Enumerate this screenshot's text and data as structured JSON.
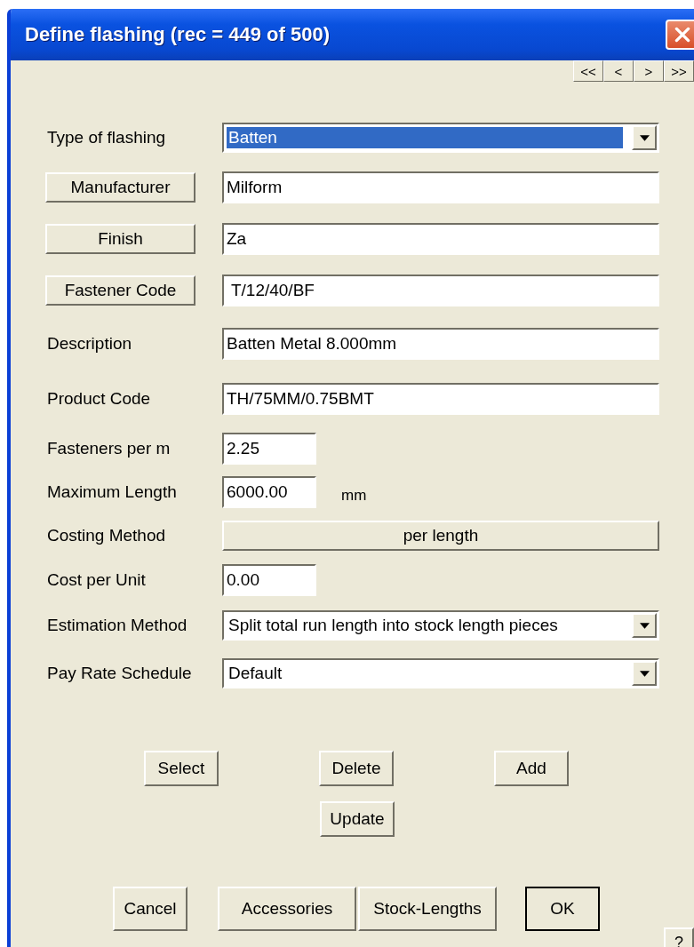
{
  "window": {
    "title": "Define flashing (rec = 449 of 500)"
  },
  "record_nav": [
    "<<",
    "<",
    ">",
    ">>"
  ],
  "rows": [
    {
      "kind": "select",
      "label": "Type of flashing",
      "value": "Batten",
      "focused": true
    },
    {
      "kind": "lookup",
      "label": "Manufacturer",
      "value": "Milform"
    },
    {
      "kind": "lookup",
      "label": "Finish",
      "value": "Za"
    },
    {
      "kind": "lookup",
      "label": "Fastener Code",
      "value": " T/12/40/BF"
    },
    {
      "kind": "field",
      "label": "Description",
      "value": "Batten Metal 8.000mm"
    },
    {
      "kind": "field",
      "label": "Product Code",
      "value": "TH/75MM/0.75BMT"
    },
    {
      "kind": "short_field",
      "label": "Fasteners per m",
      "value": "2.25"
    },
    {
      "kind": "short_field",
      "label": "Maximum Length",
      "value": "6000.00",
      "unit": "mm"
    },
    {
      "kind": "choice",
      "label": "Costing Method",
      "value": "per length"
    },
    {
      "kind": "short_field",
      "label": "Cost per Unit",
      "value": "0.00"
    },
    {
      "kind": "select",
      "label": "Estimation Method",
      "value": "Split total run length into stock length pieces",
      "focused": false
    },
    {
      "kind": "select",
      "label": "Pay Rate Schedule",
      "value": "Default",
      "focused": false
    }
  ],
  "record_actions": [
    [
      "Select",
      "Delete",
      "Add"
    ],
    [
      "Update"
    ]
  ],
  "dialog_buttons": [
    {
      "label": "Cancel",
      "default": false
    },
    {
      "label": "Accessories",
      "default": false
    },
    {
      "label": "Stock-Lengths",
      "default": false
    },
    {
      "label": "OK",
      "default": true
    }
  ],
  "help_button": "?"
}
